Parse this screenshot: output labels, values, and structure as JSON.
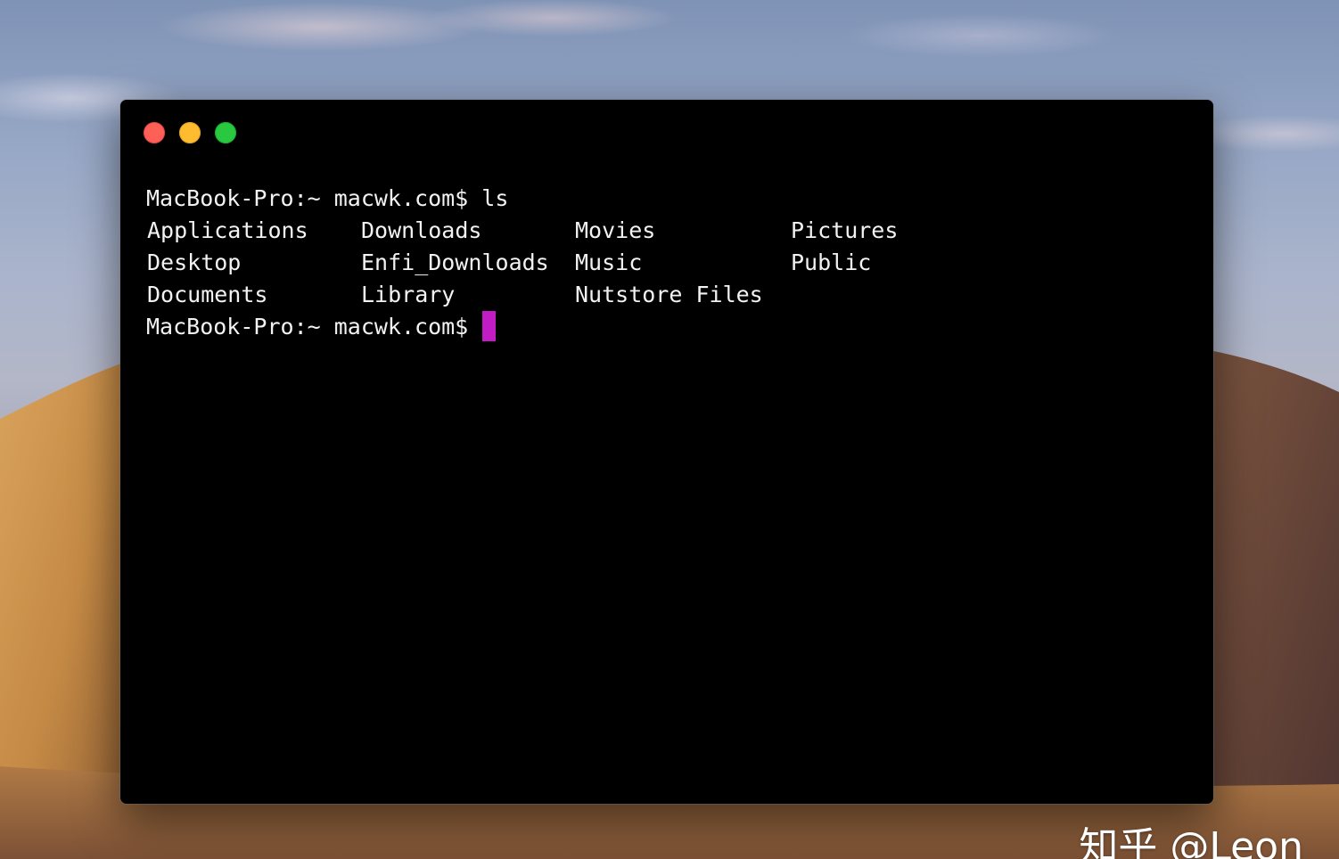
{
  "terminal": {
    "prompt": "MacBook-Pro:~ macwk.com$",
    "command": "ls",
    "listing": [
      [
        "Applications",
        "Downloads",
        "Movies",
        "Pictures"
      ],
      [
        "Desktop",
        "Enfi_Downloads",
        "Music",
        "Public"
      ],
      [
        "Documents",
        "Library",
        "Nutstore Files",
        ""
      ]
    ],
    "cursor_color": "#c21cc4"
  },
  "window": {
    "close_color": "#fe5f57",
    "minimize_color": "#febc2e",
    "zoom_color": "#28c840"
  },
  "watermark": {
    "text": "知乎 @Leon"
  }
}
